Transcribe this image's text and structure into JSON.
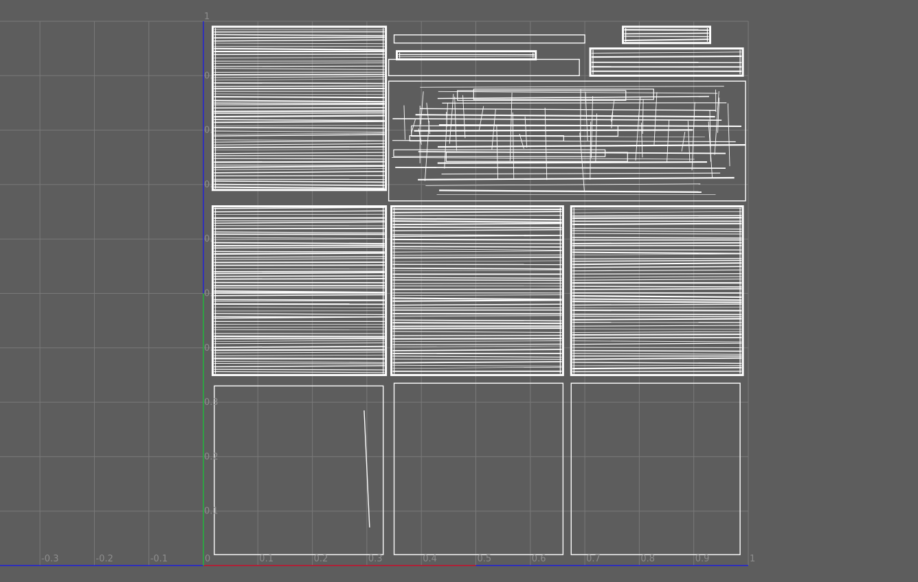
{
  "editor": {
    "title": "",
    "grid_visible": true,
    "colors": {
      "background": "#5d5d5d",
      "grid_line": "#7a7a7a",
      "tick_label": "#8e8e8e",
      "uv_wire": "#ffffff",
      "u_axis": "#d01818",
      "v_axis": "#28c428",
      "frame_axis": "#2020d8"
    }
  },
  "axes": {
    "u_range": [
      -0.4,
      1.0
    ],
    "v_range": [
      0.0,
      1.0
    ],
    "u_ticks": [
      {
        "value": -0.4,
        "label": "4"
      },
      {
        "value": -0.3,
        "label": "-0.3"
      },
      {
        "value": -0.2,
        "label": "-0.2"
      },
      {
        "value": -0.1,
        "label": "-0.1"
      },
      {
        "value": 0.0,
        "label": "0"
      },
      {
        "value": 0.1,
        "label": "0.1"
      },
      {
        "value": 0.2,
        "label": "0.2"
      },
      {
        "value": 0.3,
        "label": "0.3"
      },
      {
        "value": 0.4,
        "label": "0.4"
      },
      {
        "value": 0.5,
        "label": "0.5"
      },
      {
        "value": 0.6,
        "label": "0.6"
      },
      {
        "value": 0.7,
        "label": "0.7"
      },
      {
        "value": 0.8,
        "label": "0.8"
      },
      {
        "value": 0.9,
        "label": "0.9"
      },
      {
        "value": 1.0,
        "label": "1"
      }
    ],
    "v_ticks": [
      {
        "value": 1.0,
        "label": "1"
      },
      {
        "value": 0.9,
        "label": "0."
      },
      {
        "value": 0.8,
        "label": "0."
      },
      {
        "value": 0.7,
        "label": "0."
      },
      {
        "value": 0.6,
        "label": "0."
      },
      {
        "value": 0.5,
        "label": "0."
      },
      {
        "value": 0.4,
        "label": "0."
      },
      {
        "value": 0.3,
        "label": "0.3"
      },
      {
        "value": 0.2,
        "label": "0.2"
      },
      {
        "value": 0.1,
        "label": "0.1"
      }
    ]
  },
  "uv_islands": [
    {
      "name": "uv-island-striped-a",
      "kind": "striped",
      "u": [
        0.017,
        0.335
      ],
      "v": [
        0.69,
        0.99
      ],
      "lines": 58
    },
    {
      "name": "uv-island-thin-strip-1",
      "kind": "outline",
      "u": [
        0.35,
        0.7
      ],
      "v": [
        0.96,
        0.975
      ]
    },
    {
      "name": "uv-island-thin-strip-2",
      "kind": "striped",
      "u": [
        0.355,
        0.61
      ],
      "v": [
        0.93,
        0.945
      ],
      "lines": 3
    },
    {
      "name": "uv-island-thin-strip-3",
      "kind": "outline",
      "u": [
        0.34,
        0.69
      ],
      "v": [
        0.9,
        0.93
      ]
    },
    {
      "name": "uv-island-small-parts-a",
      "kind": "striped",
      "u": [
        0.77,
        0.93
      ],
      "v": [
        0.96,
        0.99
      ],
      "lines": 5
    },
    {
      "name": "uv-island-small-parts-b",
      "kind": "striped",
      "u": [
        0.71,
        0.99
      ],
      "v": [
        0.9,
        0.95
      ],
      "lines": 6
    },
    {
      "name": "uv-island-mesh-cluster",
      "kind": "mesh",
      "u": [
        0.34,
        0.995
      ],
      "v": [
        0.67,
        0.89
      ],
      "lines": 22
    },
    {
      "name": "uv-island-striped-b",
      "kind": "striped",
      "u": [
        0.017,
        0.335
      ],
      "v": [
        0.35,
        0.66
      ],
      "lines": 60
    },
    {
      "name": "uv-island-striped-c",
      "kind": "striped",
      "u": [
        0.345,
        0.66
      ],
      "v": [
        0.35,
        0.66
      ],
      "lines": 55
    },
    {
      "name": "uv-island-striped-d",
      "kind": "striped",
      "u": [
        0.675,
        0.99
      ],
      "v": [
        0.35,
        0.66
      ],
      "lines": 55
    },
    {
      "name": "uv-island-quad-a",
      "kind": "outline",
      "u": [
        0.02,
        0.33
      ],
      "v": [
        0.02,
        0.33
      ]
    },
    {
      "name": "uv-island-quad-b",
      "kind": "outline",
      "u": [
        0.35,
        0.66
      ],
      "v": [
        0.02,
        0.335
      ]
    },
    {
      "name": "uv-island-quad-c",
      "kind": "outline",
      "u": [
        0.675,
        0.985
      ],
      "v": [
        0.02,
        0.335
      ]
    }
  ]
}
